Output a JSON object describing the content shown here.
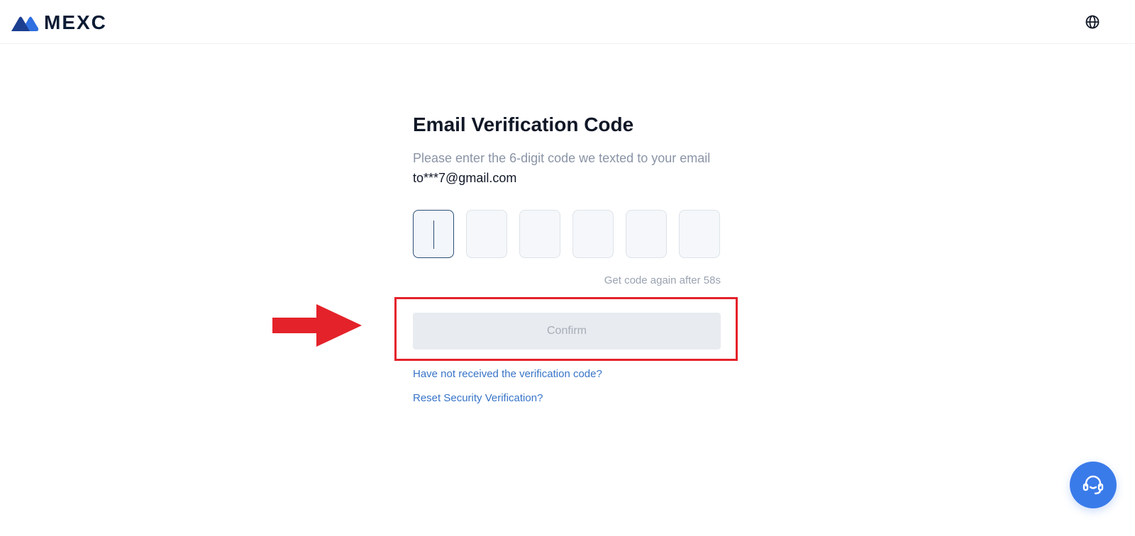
{
  "header": {
    "logo_text": "MEXC",
    "logo_icon": "mexc-mountain-logo",
    "language_icon": "globe-icon"
  },
  "verification": {
    "title": "Email Verification Code",
    "subtitle_prefix": "Please enter the 6-digit code we texted to your email",
    "email": "to***7@gmail.com",
    "code_digits": [
      "",
      "",
      "",
      "",
      "",
      ""
    ],
    "resend_text": "Get code again after 58s",
    "confirm_label": "Confirm",
    "link_not_received": "Have not received the verification code?",
    "link_reset": "Reset Security Verification?"
  },
  "annotation": {
    "arrow_icon": "red-arrow-right",
    "highlight_color": "#e4222a"
  },
  "support": {
    "icon": "customer-support-icon",
    "color": "#3a7bea"
  }
}
